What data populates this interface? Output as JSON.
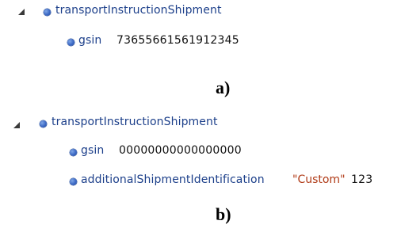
{
  "panel_a": {
    "root": {
      "name": "transportInstructionShipment",
      "expanded": true,
      "children": [
        {
          "name": "gsin",
          "value": "73655661561912345"
        }
      ]
    },
    "caption": "a)"
  },
  "panel_b": {
    "root": {
      "name": "transportInstructionShipment",
      "expanded": true,
      "children": [
        {
          "name": "gsin",
          "value": "00000000000000000"
        },
        {
          "name": "additionalShipmentIdentification",
          "string_value": "\"Custom\"",
          "value": "123"
        }
      ]
    },
    "caption": "b)"
  },
  "colors": {
    "node_name": "#1c3f8a",
    "node_icon": "#3b68c4",
    "string_literal": "#b03a16",
    "value_text": "#111111"
  },
  "icons": {
    "expander": "collapse-triangle-icon",
    "node": "node-bullet-icon"
  }
}
